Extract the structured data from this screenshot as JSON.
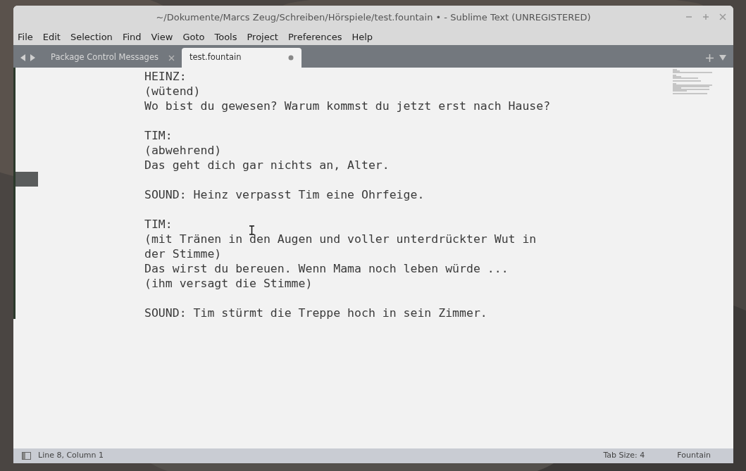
{
  "window": {
    "title": "~/Dokumente/Marcs Zeug/Schreiben/Hörspiele/test.fountain • - Sublime Text (UNREGISTERED)"
  },
  "menu": [
    "File",
    "Edit",
    "Selection",
    "Find",
    "View",
    "Goto",
    "Tools",
    "Project",
    "Preferences",
    "Help"
  ],
  "tabs": [
    {
      "label": "Package Control Messages",
      "selected": false,
      "modified": false
    },
    {
      "label": "test.fountain",
      "selected": true,
      "modified": true
    }
  ],
  "editor": {
    "blocks": [
      {
        "lines": [
          "HEINZ:",
          "(wütend)",
          "Wo bist du gewesen? Warum kommst du jetzt erst nach Hause?"
        ]
      },
      {
        "lines": [
          "TIM:",
          "(abwehrend)",
          "Das geht dich gar nichts an, Alter."
        ]
      },
      {
        "lines": [
          "SOUND: Heinz verpasst Tim eine Ohrfeige."
        ]
      },
      {
        "lines": [
          "TIM:",
          "(mit Tränen in den Augen und voller unterdrückter Wut in",
          "der Stimme)",
          "Das wirst du bereuen. Wenn Mama noch leben würde ...",
          "(ihm versagt die Stimme)"
        ]
      },
      {
        "lines": [
          "SOUND: Tim stürmt die Treppe hoch in sein Zimmer."
        ]
      }
    ]
  },
  "status_bar": {
    "position": "Line 8, Column 1",
    "tab_size": "Tab Size: 4",
    "syntax": "Fountain"
  }
}
